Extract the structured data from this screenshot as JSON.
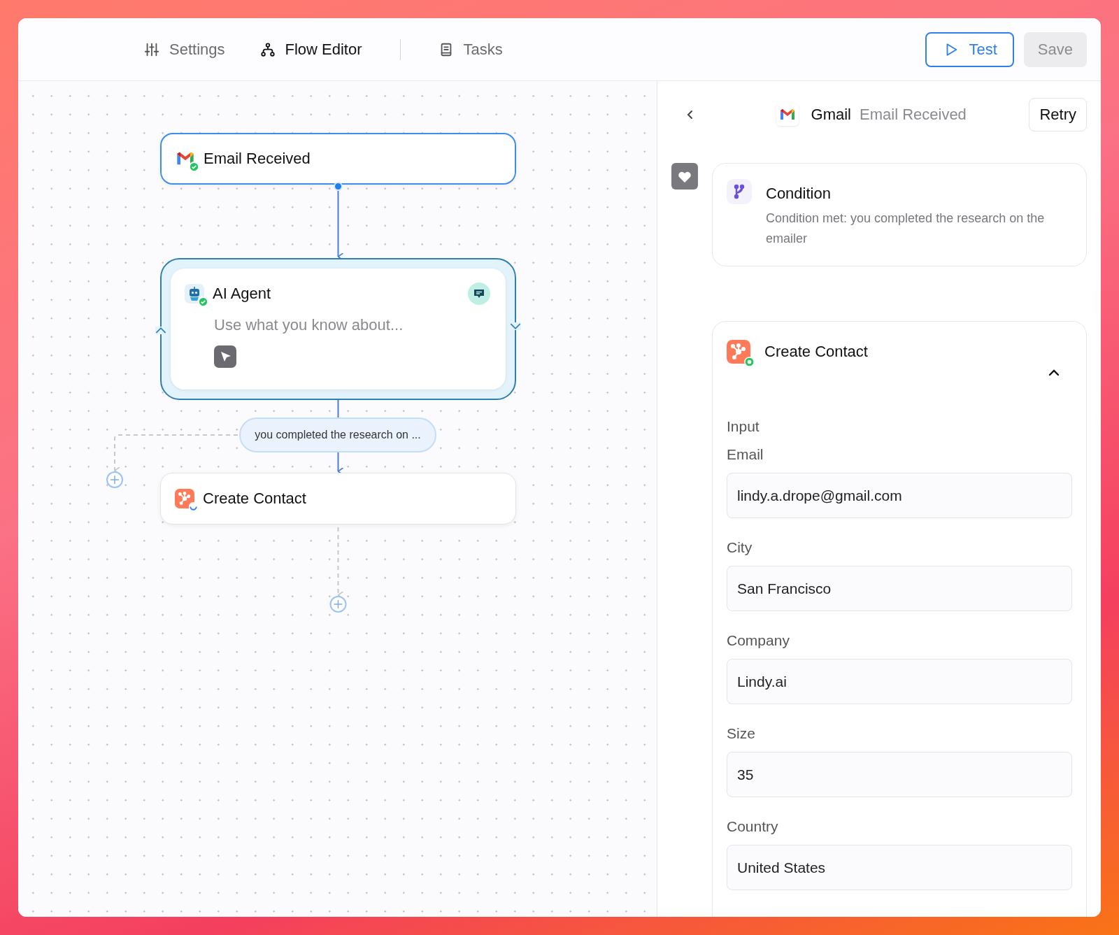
{
  "tabs": [
    {
      "kind": "settings",
      "label": "Settings",
      "selected": false
    },
    {
      "kind": "flow",
      "label": "Flow Editor",
      "selected": true
    },
    {
      "kind": "tasks",
      "label": "Tasks",
      "selected": false
    }
  ],
  "toolbar": {
    "test": "Test",
    "save": {
      "label": "Save",
      "disabled": true
    }
  },
  "canvas": {
    "nodes": [
      {
        "kind": "trigger",
        "title": "Email Received",
        "completed": true,
        "selected": true
      },
      {
        "kind": "agent",
        "title": "AI Agent",
        "subtitle": "Use what you know about...",
        "completed": true,
        "selected": false
      },
      {
        "kind": "action",
        "title": "Create Contact",
        "running": true,
        "selected": false
      }
    ],
    "condition_label": "you completed the research on ..."
  },
  "panel": {
    "header": {
      "app": "Gmail",
      "event": "Email Received",
      "retry": "Retry"
    },
    "steps": [
      {
        "kind": "condition",
        "title": "Condition",
        "description": "Condition met: you completed the research on the emailer"
      },
      {
        "kind": "action",
        "title": "Create Contact",
        "completed": true,
        "expanded": true,
        "section": "Input",
        "fields": [
          {
            "label": "Email",
            "value": "lindy.a.drope@gmail.com"
          },
          {
            "label": "City",
            "value": "San Francisco"
          },
          {
            "label": "Company",
            "value": "Lindy.ai"
          },
          {
            "label": "Size",
            "value": "35"
          },
          {
            "label": "Country",
            "value": "United States"
          }
        ]
      }
    ]
  }
}
